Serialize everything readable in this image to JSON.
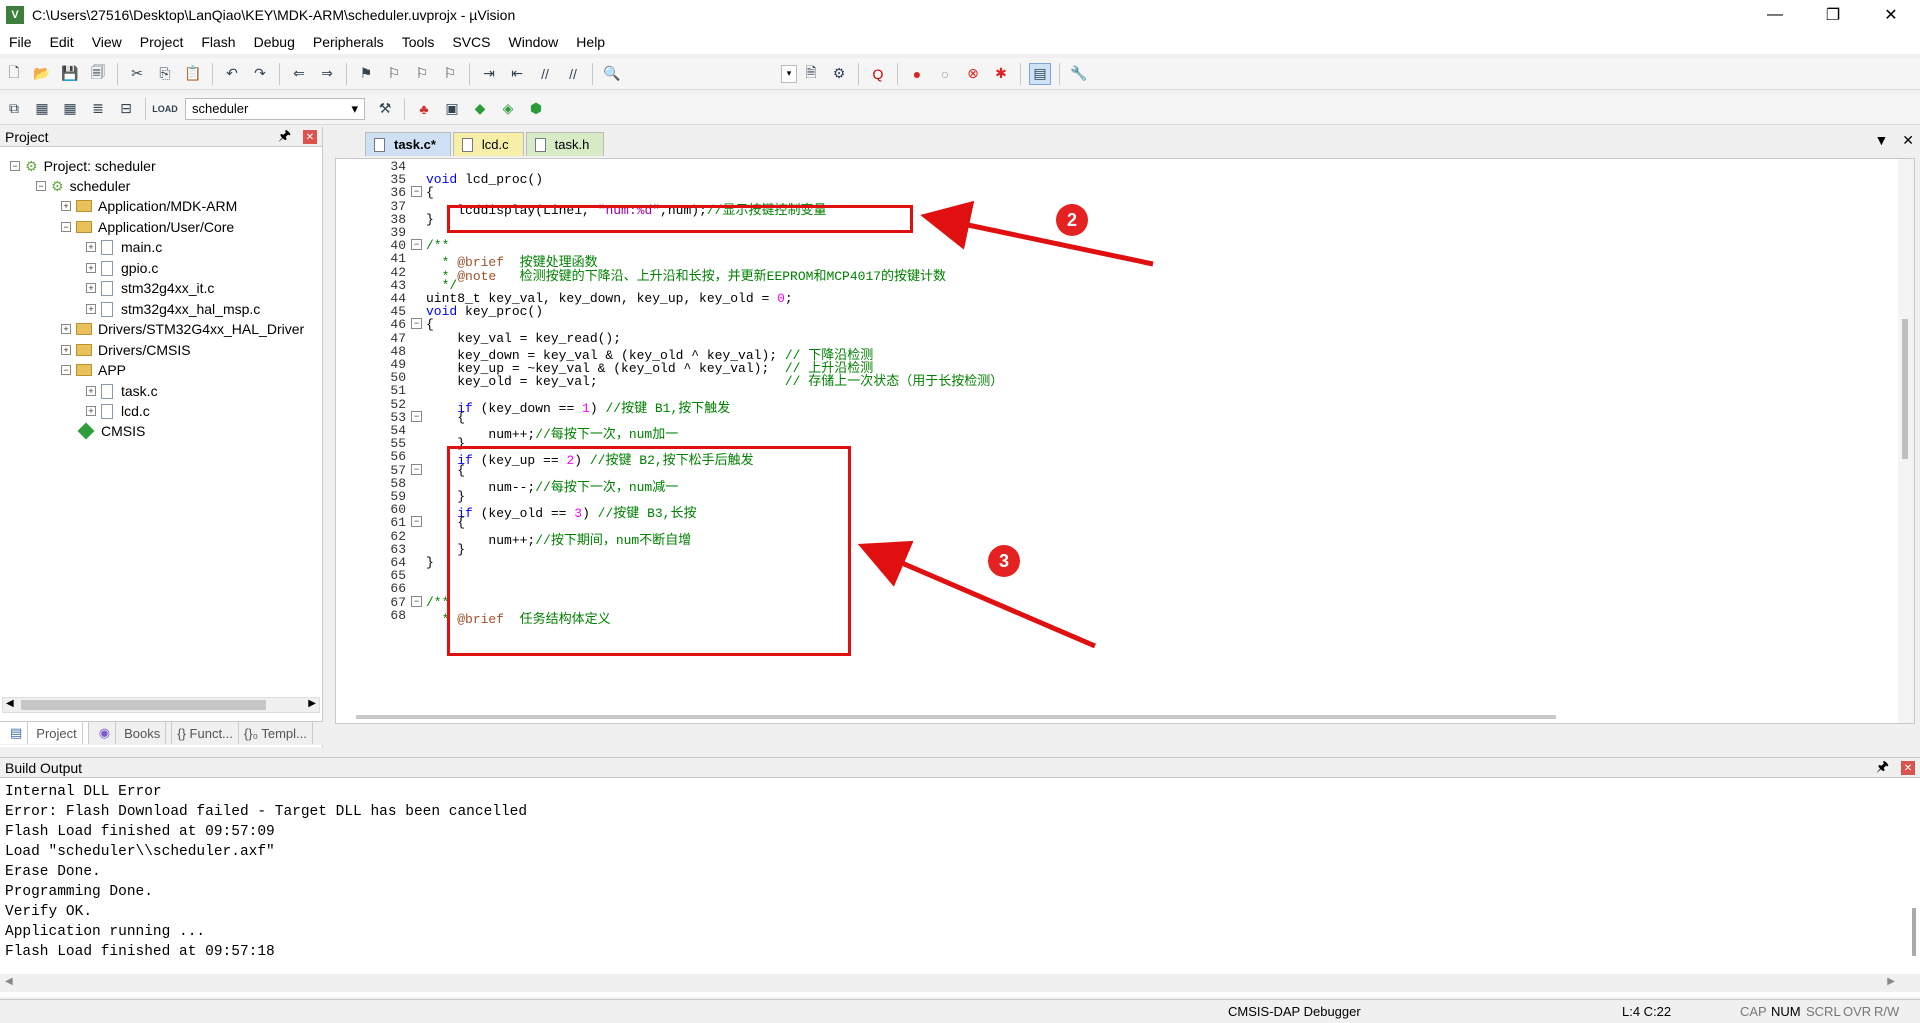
{
  "window": {
    "title": "C:\\Users\\27516\\Desktop\\LanQiao\\KEY\\MDK-ARM\\scheduler.uvprojx - µVision",
    "app_icon": "V",
    "minimize": "—",
    "maximize": "❐",
    "close": "✕"
  },
  "menu": [
    "File",
    "Edit",
    "View",
    "Project",
    "Flash",
    "Debug",
    "Peripherals",
    "Tools",
    "SVCS",
    "Window",
    "Help"
  ],
  "toolbar2": {
    "target": "scheduler"
  },
  "project_panel": {
    "title": "Project",
    "tree": [
      {
        "label": "Project: scheduler"
      },
      {
        "label": "scheduler"
      },
      {
        "label": "Application/MDK-ARM"
      },
      {
        "label": "Application/User/Core"
      },
      {
        "label": "main.c"
      },
      {
        "label": "gpio.c"
      },
      {
        "label": "stm32g4xx_it.c"
      },
      {
        "label": "stm32g4xx_hal_msp.c"
      },
      {
        "label": "Drivers/STM32G4xx_HAL_Driver"
      },
      {
        "label": "Drivers/CMSIS"
      },
      {
        "label": "APP"
      },
      {
        "label": "task.c"
      },
      {
        "label": "lcd.c"
      },
      {
        "label": "CMSIS"
      }
    ],
    "tabs": [
      "Project",
      "Books",
      "{} Funct...",
      "{}₀ Templ..."
    ]
  },
  "editor_tabs": [
    {
      "label": "task.c*",
      "color": "#cfe0f5"
    },
    {
      "label": "lcd.c",
      "color": "#f7efa8"
    },
    {
      "label": "task.h",
      "color": "#d7ebc7"
    }
  ],
  "editor_lines": [
    {
      "n": "34",
      "fold": "",
      "html": ""
    },
    {
      "n": "35",
      "fold": "",
      "html": "<span class=\"kw\">void</span> lcd_proc()"
    },
    {
      "n": "36",
      "fold": "⊟",
      "html": "{"
    },
    {
      "n": "37",
      "fold": "",
      "html": "    lcddisplay(Line1, <span class=\"str\">\"num:%d\"</span>,num);<span class=\"cm\">//显示按键控制变量</span>"
    },
    {
      "n": "38",
      "fold": "",
      "html": "}"
    },
    {
      "n": "39",
      "fold": "",
      "html": ""
    },
    {
      "n": "40",
      "fold": "⊟",
      "html": "<span class=\"cm\">/**</span>"
    },
    {
      "n": "41",
      "fold": "",
      "html": "<span class=\"cm\">  * </span><span class=\"doc\">@brief</span><span class=\"cm\">  按键处理函数</span>"
    },
    {
      "n": "42",
      "fold": "",
      "html": "<span class=\"cm\">  * </span><span class=\"doc\">@note</span><span class=\"cm\">   检测按键的下降沿、上升沿和长按，并更新EEPROM和MCP4017的按键计数</span>"
    },
    {
      "n": "43",
      "fold": "",
      "html": "<span class=\"cm\">  */</span>"
    },
    {
      "n": "44",
      "fold": "",
      "html": "uint8_t key_val, key_down, key_up, key_old = <span class=\"num\">0</span>;"
    },
    {
      "n": "45",
      "fold": "",
      "html": "<span class=\"kw\">void</span> key_proc()"
    },
    {
      "n": "46",
      "fold": "⊟",
      "html": "{"
    },
    {
      "n": "47",
      "fold": "",
      "html": "    key_val = key_read();"
    },
    {
      "n": "48",
      "fold": "",
      "html": "    key_down = key_val &amp; (key_old ^ key_val); <span class=\"cm\">// 下降沿检测</span>"
    },
    {
      "n": "49",
      "fold": "",
      "html": "    key_up = ~key_val &amp; (key_old ^ key_val);  <span class=\"cm\">// 上升沿检测</span>"
    },
    {
      "n": "50",
      "fold": "",
      "html": "    key_old = key_val;                        <span class=\"cm\">// 存储上一次状态（用于长按检测）</span>"
    },
    {
      "n": "51",
      "fold": "",
      "html": ""
    },
    {
      "n": "52",
      "fold": "",
      "html": "    <span class=\"kw\">if</span> (key_down == <span class=\"num\">1</span>) <span class=\"cm\">//按键 B1,按下触发</span>"
    },
    {
      "n": "53",
      "fold": "⊟",
      "html": "    {"
    },
    {
      "n": "54",
      "fold": "",
      "html": "        num++;<span class=\"cm\">//每按下一次，num加一</span>"
    },
    {
      "n": "55",
      "fold": "",
      "html": "    }"
    },
    {
      "n": "56",
      "fold": "",
      "html": "    <span class=\"kw\">if</span> (key_up == <span class=\"num\">2</span>) <span class=\"cm\">//按键 B2,按下松手后触发</span>"
    },
    {
      "n": "57",
      "fold": "⊟",
      "html": "    {"
    },
    {
      "n": "58",
      "fold": "",
      "html": "        num--;<span class=\"cm\">//每按下一次，num减一</span>"
    },
    {
      "n": "59",
      "fold": "",
      "html": "    }"
    },
    {
      "n": "60",
      "fold": "",
      "html": "    <span class=\"kw\">if</span> (key_old == <span class=\"num\">3</span>) <span class=\"cm\">//按键 B3,长按</span>"
    },
    {
      "n": "61",
      "fold": "⊟",
      "html": "    {"
    },
    {
      "n": "62",
      "fold": "",
      "html": "        num++;<span class=\"cm\">//按下期间，num不断自增</span>"
    },
    {
      "n": "63",
      "fold": "",
      "html": "    }"
    },
    {
      "n": "64",
      "fold": "",
      "html": "}"
    },
    {
      "n": "65",
      "fold": "",
      "html": ""
    },
    {
      "n": "66",
      "fold": "",
      "html": ""
    },
    {
      "n": "67",
      "fold": "⊟",
      "html": "<span class=\"cm\">/**</span>"
    },
    {
      "n": "68",
      "fold": "",
      "html": "<span class=\"cm\">  * </span><span class=\"doc\">@brief</span><span class=\"cm\">  任务结构体定义</span>"
    }
  ],
  "annotations": {
    "badge2": "2",
    "badge3": "3",
    "arrow_color": "#e01010"
  },
  "build_output": {
    "title": "Build Output",
    "lines": [
      "Internal DLL Error",
      "Error: Flash Download failed  -  Target DLL has been cancelled",
      "Flash Load finished at 09:57:09",
      "Load \"scheduler\\\\scheduler.axf\"",
      "Erase Done.",
      "Programming Done.",
      "Verify OK.",
      "Application running ...",
      "Flash Load finished at 09:57:18"
    ]
  },
  "statusbar": {
    "debugger": "CMSIS-DAP Debugger",
    "position": "L:4 C:22",
    "cap": "CAP",
    "num": "NUM",
    "scrl": "SCRL",
    "ovr": "OVR",
    "rw": "R/W"
  }
}
